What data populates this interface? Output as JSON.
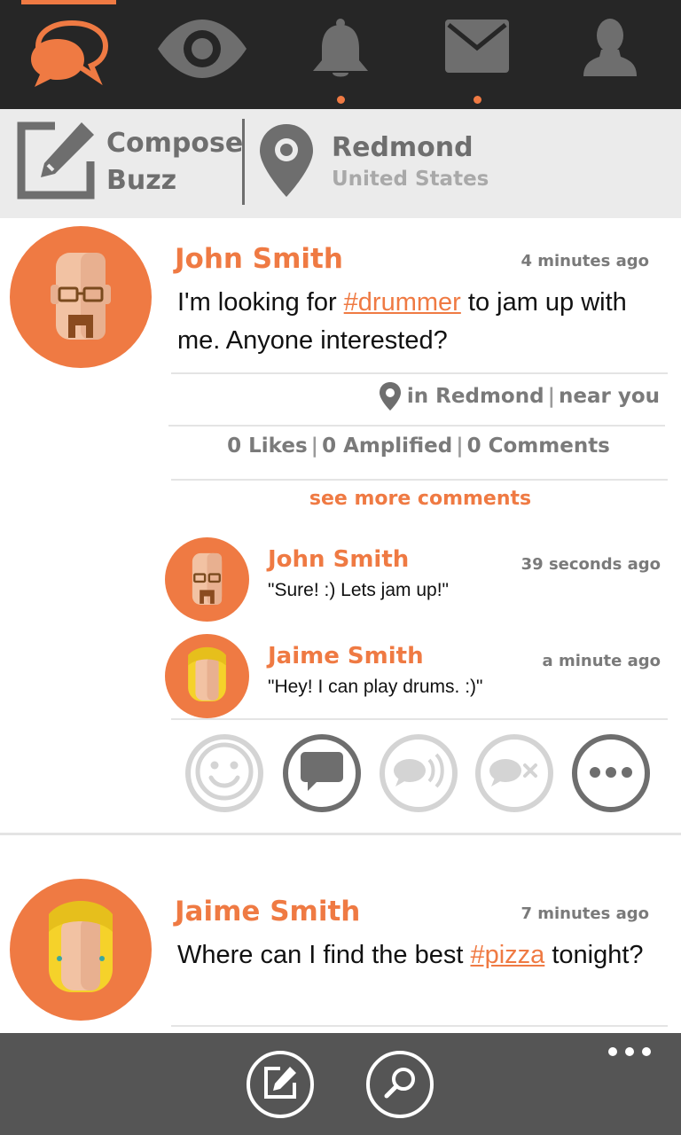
{
  "nav": {
    "items": [
      {
        "icon": "chat-bubbles-icon",
        "active": true
      },
      {
        "icon": "eye-icon"
      },
      {
        "icon": "bell-icon",
        "has_dot": true
      },
      {
        "icon": "mail-icon",
        "has_dot": true
      },
      {
        "icon": "profile-icon"
      }
    ]
  },
  "compose": {
    "label_line1": "Compose",
    "label_line2": "Buzz"
  },
  "location": {
    "city": "Redmond",
    "country": "United States"
  },
  "posts": [
    {
      "author": "John Smith",
      "time": "4 minutes ago",
      "text_before": "I'm looking for ",
      "hashtag": "#drummer",
      "text_after": " to jam up with me. Anyone interested?",
      "location_text": "in Redmond",
      "proximity": "near you",
      "likes": "0 Likes",
      "amplified": "0 Amplified",
      "comments_count": "0 Comments",
      "see_more": "see more comments",
      "comments": [
        {
          "author": "John Smith",
          "time": "39 seconds ago",
          "text": "\"Sure! :) Lets jam up!\""
        },
        {
          "author": "Jaime Smith",
          "time": "a minute ago",
          "text": "\"Hey! I can play drums. :)\""
        }
      ]
    },
    {
      "author": "Jaime Smith",
      "time": "7 minutes ago",
      "text_before": "Where can I find the best ",
      "hashtag": "#pizza",
      "text_after": " tonight?"
    }
  ],
  "actions": [
    "smile-icon",
    "comment-icon",
    "amplify-icon",
    "mute-icon",
    "more-icon"
  ],
  "colors": {
    "accent": "#ef7a43",
    "nav_bg": "#262626",
    "bottom_bar": "#555555"
  }
}
